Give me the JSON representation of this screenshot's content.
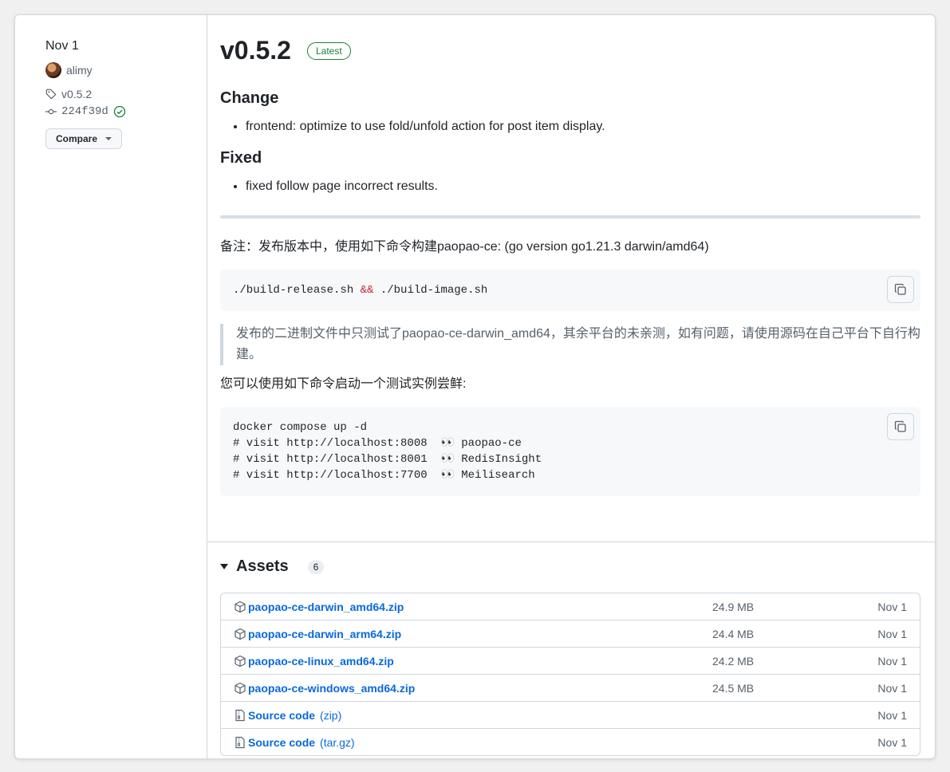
{
  "meta": {
    "date": "Nov 1",
    "author": "alimy",
    "tag": "v0.5.2",
    "commit": "224f39d",
    "compare_label": "Compare"
  },
  "release": {
    "title": "v0.5.2",
    "badge": "Latest",
    "change_heading": "Change",
    "change_items": [
      "frontend: optimize to use fold/unfold action for post item display."
    ],
    "fixed_heading": "Fixed",
    "fixed_items": [
      "fixed follow page incorrect results."
    ],
    "note": "备注：发布版本中，使用如下命令构建paopao-ce: (go version go1.21.3 darwin/amd64)",
    "code1_a": "./build-release.sh ",
    "code1_amp": "&&",
    "code1_b": " ./build-image.sh",
    "quote": "发布的二进制文件中只测试了paopao-ce-darwin_amd64，其余平台的未亲测，如有问题，请使用源码在自己平台下自行构建。",
    "try_text": "您可以使用如下命令启动一个测试实例尝鲜:",
    "code2_lines": [
      "docker compose up -d",
      "# visit http://localhost:8008  👀 paopao-ce",
      "# visit http://localhost:8001  👀 RedisInsight",
      "# visit http://localhost:7700  👀 Meilisearch"
    ]
  },
  "assets": {
    "title": "Assets",
    "count": "6",
    "items": [
      {
        "name": "paopao-ce-darwin_amd64.zip",
        "extra": "",
        "size": "24.9 MB",
        "date": "Nov 1",
        "icon": "package-icon"
      },
      {
        "name": "paopao-ce-darwin_arm64.zip",
        "extra": "",
        "size": "24.4 MB",
        "date": "Nov 1",
        "icon": "package-icon"
      },
      {
        "name": "paopao-ce-linux_amd64.zip",
        "extra": "",
        "size": "24.2 MB",
        "date": "Nov 1",
        "icon": "package-icon"
      },
      {
        "name": "paopao-ce-windows_amd64.zip",
        "extra": "",
        "size": "24.5 MB",
        "date": "Nov 1",
        "icon": "package-icon"
      },
      {
        "name": "Source code",
        "extra": "(zip)",
        "size": "",
        "date": "Nov 1",
        "icon": "file-zip-icon"
      },
      {
        "name": "Source code",
        "extra": "(tar.gz)",
        "size": "",
        "date": "Nov 1",
        "icon": "file-zip-icon"
      }
    ]
  },
  "colors": {
    "link": "#0969da",
    "success": "#1a7f37",
    "muted": "#57606a"
  }
}
